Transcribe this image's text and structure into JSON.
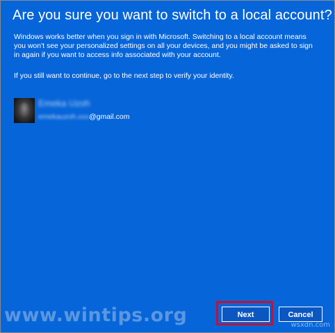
{
  "dialog": {
    "title": "Are you sure you want to switch to a local account?",
    "paragraph1": "Windows works better when you sign in with Microsoft. Switching to a local account means you won't see your personalized settings on all your devices, and you might be asked to sign in again if you want to access info associated with your account.",
    "paragraph2": "If you still want to continue, go to the next step to verify your identity."
  },
  "account": {
    "name": "Emeka Uzoh",
    "email_user": "emekauzoh.xxx",
    "email_domain": "@gmail.com"
  },
  "buttons": {
    "next_label": "Next",
    "cancel_label": "Cancel"
  },
  "watermark": {
    "text": "www.wintips.org",
    "corner_text": "wsxdn.com"
  },
  "colors": {
    "background": "#0665d9",
    "highlight": "#c8102e",
    "text": "#ffffff"
  }
}
